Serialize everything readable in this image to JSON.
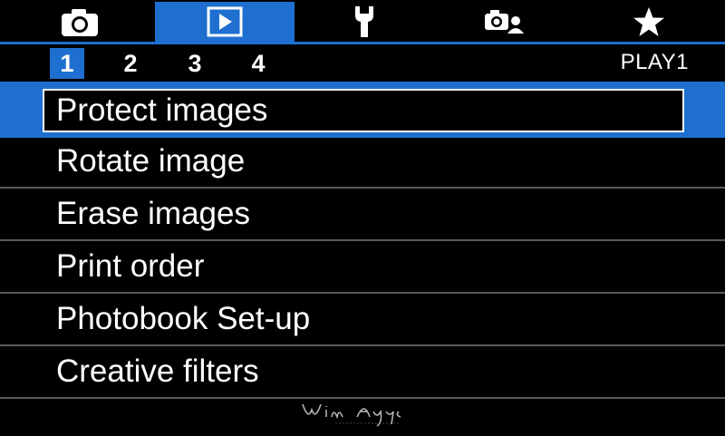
{
  "tabs": [
    {
      "name": "shooting",
      "icon": "camera-icon",
      "active": false
    },
    {
      "name": "playback",
      "icon": "playback-icon",
      "active": true
    },
    {
      "name": "setup",
      "icon": "wrench-icon",
      "active": false
    },
    {
      "name": "custom",
      "icon": "custom-functions-icon",
      "active": false
    },
    {
      "name": "my-menu",
      "icon": "star-icon",
      "active": false
    }
  ],
  "pages": [
    "1",
    "2",
    "3",
    "4"
  ],
  "active_page": "1",
  "menu_tab_label": "PLAY1",
  "items": [
    {
      "label": "Protect images",
      "selected": true
    },
    {
      "label": "Rotate image",
      "selected": false
    },
    {
      "label": "Erase images",
      "selected": false
    },
    {
      "label": "Print order",
      "selected": false
    },
    {
      "label": "Photobook Set-up",
      "selected": false
    },
    {
      "label": "Creative filters",
      "selected": false
    }
  ],
  "colors": {
    "accent": "#1e6fd0",
    "divider": "#5a5a5a",
    "background": "#000000"
  }
}
